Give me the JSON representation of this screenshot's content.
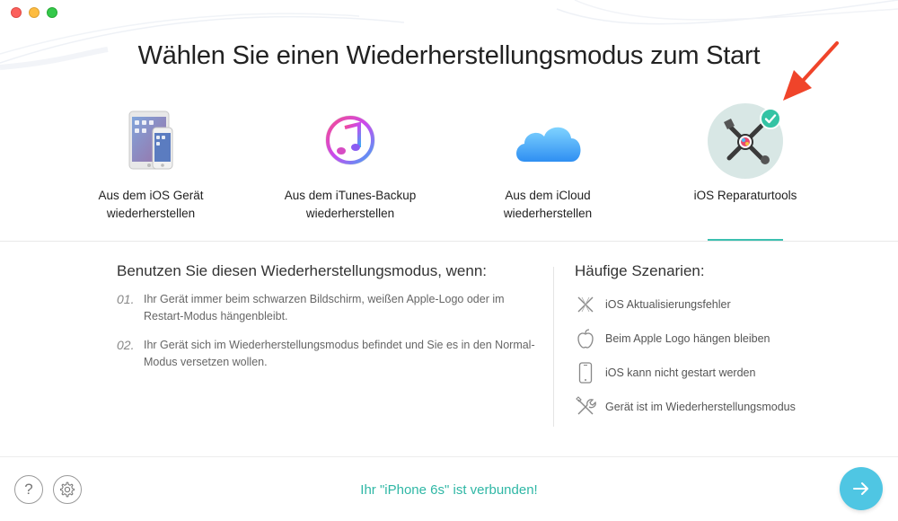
{
  "window": {
    "controls": [
      "close",
      "minimize",
      "maximize"
    ]
  },
  "title": "Wählen Sie einen Wiederherstellungsmodus zum Start",
  "modes": [
    {
      "label": "Aus dem iOS Gerät\nwiederherstellen",
      "icon": "ios-device-icon"
    },
    {
      "label": "Aus dem iTunes-Backup\nwiederherstellen",
      "icon": "itunes-icon"
    },
    {
      "label": "Aus dem iCloud\nwiederherstellen",
      "icon": "icloud-icon"
    },
    {
      "label": "iOS Reparaturtools",
      "icon": "repair-tools-icon",
      "selected": true
    }
  ],
  "left": {
    "heading": "Benutzen Sie diesen Wiederherstellungsmodus, wenn:",
    "steps": [
      {
        "num": "01.",
        "text": "Ihr Gerät immer beim schwarzen Bildschirm, weißen Apple-Logo oder im Restart-Modus hängenbleibt."
      },
      {
        "num": "02.",
        "text": "Ihr Gerät sich im Wiederherstellungsmodus befindet und Sie es in den Normal-Modus versetzen wollen."
      }
    ]
  },
  "right": {
    "heading": "Häufige Szenarien:",
    "scenarios": [
      {
        "text": "iOS Aktualisierungsfehler",
        "icon": "update-error-icon"
      },
      {
        "text": "Beim Apple Logo hängen bleiben",
        "icon": "apple-logo-icon"
      },
      {
        "text": "iOS kann nicht gestart werden",
        "icon": "phone-icon"
      },
      {
        "text": "Gerät ist im Wiederherstellungsmodus",
        "icon": "tools-icon"
      }
    ]
  },
  "footer": {
    "help_label": "?",
    "status": "Ihr \"iPhone 6s\" ist verbunden!"
  },
  "colors": {
    "accent": "#3cc0b0",
    "next_button": "#4fc6e3",
    "annotation_arrow": "#f0442a",
    "check_badge": "#34c3a4"
  }
}
